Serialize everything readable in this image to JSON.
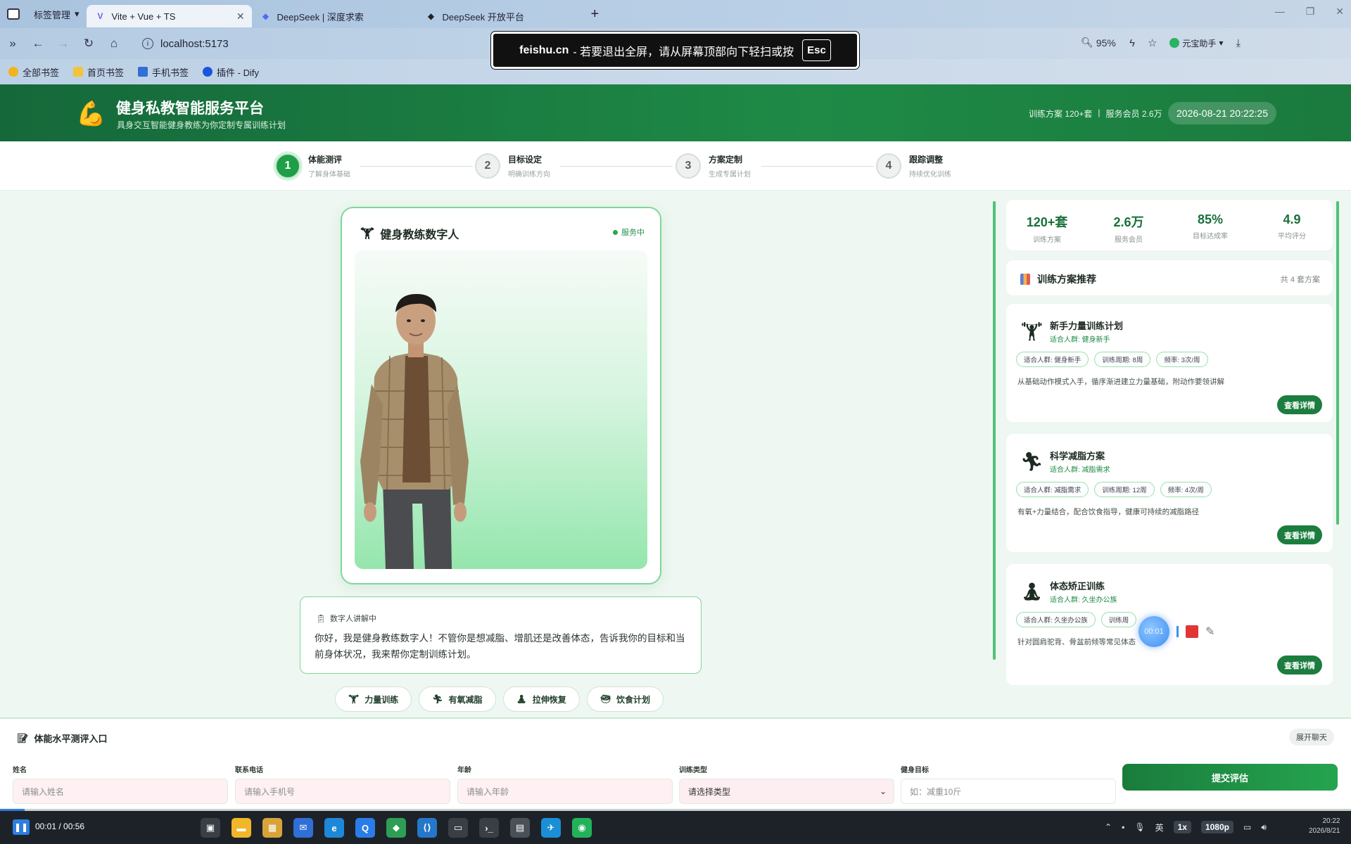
{
  "browser": {
    "tab_group": "标签管理",
    "tabs": [
      {
        "label": "Vite + Vue + TS",
        "active": true
      },
      {
        "label": "DeepSeek | 深度求索",
        "active": false
      },
      {
        "label": "DeepSeek 开放平台",
        "active": false
      }
    ],
    "url": "localhost:5173",
    "zoom": "95%",
    "assistant": "元宝助手",
    "bookmarks": [
      "全部书签",
      "首页书签",
      "手机书签",
      "插件 - Dify"
    ],
    "fullscreen_toast": {
      "site": "feishu.cn",
      "message": " - 若要退出全屏，请从屏幕顶部向下轻扫或按",
      "key": "Esc"
    }
  },
  "header": {
    "title": "健身私教智能服务平台",
    "subtitle": "具身交互智能健身教练为你定制专属训练计划",
    "stat_plans": "训练方案 120+套",
    "separator": "|",
    "stat_members": "服务会员 2.6万",
    "datetime": "2026-08-21 20:22:25"
  },
  "steps": [
    {
      "num": "1",
      "title": "体能测评",
      "desc": "了解身体基础",
      "active": true
    },
    {
      "num": "2",
      "title": "目标设定",
      "desc": "明确训练方向",
      "active": false
    },
    {
      "num": "3",
      "title": "方案定制",
      "desc": "生成专属计划",
      "active": false
    },
    {
      "num": "4",
      "title": "跟踪调整",
      "desc": "持续优化训练",
      "active": false
    }
  ],
  "avatar": {
    "title": "健身教练数字人",
    "status": "服务中",
    "speech_label": "数字人讲解中",
    "speech_text": "你好，我是健身教练数字人！不管你是想减脂、增肌还是改善体态，告诉我你的目标和当前身体状况，我来帮你定制训练计划。"
  },
  "quick_actions": [
    {
      "label": "力量训练",
      "icon": "dumbbell-icon"
    },
    {
      "label": "有氧减脂",
      "icon": "runner-icon"
    },
    {
      "label": "拉伸恢复",
      "icon": "yoga-icon"
    },
    {
      "label": "饮食计划",
      "icon": "salad-icon"
    }
  ],
  "stats": [
    {
      "value": "120+套",
      "label": "训练方案"
    },
    {
      "value": "2.6万",
      "label": "服务会员"
    },
    {
      "value": "85%",
      "label": "目标达成率"
    },
    {
      "value": "4.9",
      "label": "平均评分"
    }
  ],
  "plans_header": {
    "title": "训练方案推荐",
    "count": "共 4 套方案"
  },
  "plans": [
    {
      "name": "新手力量训练计划",
      "who": "适合人群: 健身新手",
      "tags": [
        "适合人群: 健身新手",
        "训练周期: 8周",
        "频率: 3次/周"
      ],
      "desc": "从基础动作模式入手，循序渐进建立力量基础，附动作要领讲解",
      "button": "查看详情",
      "icon": "dumbbell-icon"
    },
    {
      "name": "科学减脂方案",
      "who": "适合人群: 减脂需求",
      "tags": [
        "适合人群: 减脂需求",
        "训练周期: 12周",
        "频率: 4次/周"
      ],
      "desc": "有氧+力量结合，配合饮食指导，健康可持续的减脂路径",
      "button": "查看详情",
      "icon": "runner-icon"
    },
    {
      "name": "体态矫正训练",
      "who": "适合人群: 久坐办公族",
      "tags": [
        "适合人群: 久坐办公族",
        "训练周"
      ],
      "desc": "针对圆肩驼背、骨盆前倾等常见体态",
      "button": "查看详情",
      "icon": "yoga-icon"
    }
  ],
  "recorder": {
    "time": "00:01"
  },
  "assessment": {
    "title": "体能水平测评入口",
    "expand": "展开聊天",
    "fields": [
      {
        "label": "姓名",
        "placeholder": "请输入姓名"
      },
      {
        "label": "联系电话",
        "placeholder": "请输入手机号"
      },
      {
        "label": "年龄",
        "placeholder": "请输入年龄"
      },
      {
        "label": "训练类型",
        "placeholder": "请选择类型"
      },
      {
        "label": "健身目标",
        "placeholder": "如：减重10斤"
      }
    ],
    "submit": "提交评估"
  },
  "taskbar": {
    "time": "00:01 / 00:56",
    "speed": "1x",
    "quality": "1080p",
    "ime": "英",
    "clock": "20:22",
    "date": "2026/8/21",
    "progress": 0.018
  }
}
